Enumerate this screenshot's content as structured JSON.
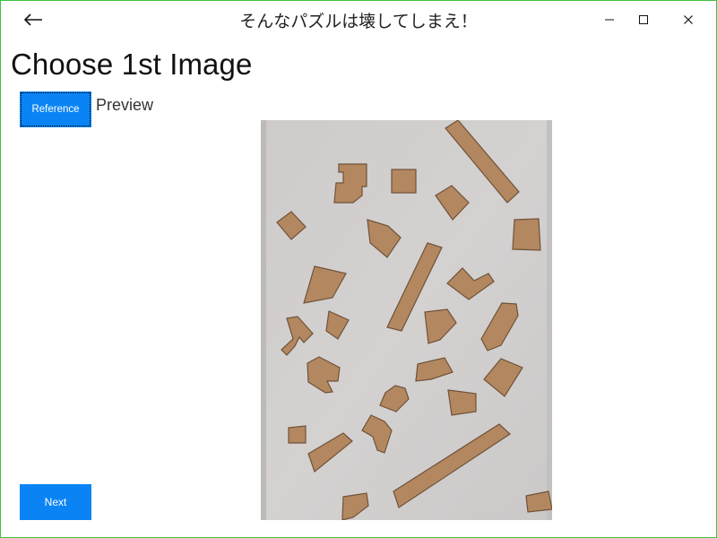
{
  "window": {
    "title": "そんなパズルは壊してしまえ！",
    "back_icon": "arrow-left-icon",
    "controls": {
      "minimize_icon": "minimize-icon",
      "maximize_icon": "maximize-icon",
      "close_icon": "close-icon"
    }
  },
  "page": {
    "title": "Choose 1st Image",
    "reference_button": "Reference",
    "preview_label": "Preview",
    "next_button": "Next"
  },
  "colors": {
    "accent": "#0a84f5",
    "window_border": "#3fc43f",
    "photo_background": "#d0cdcd",
    "cork": "#b38860"
  }
}
